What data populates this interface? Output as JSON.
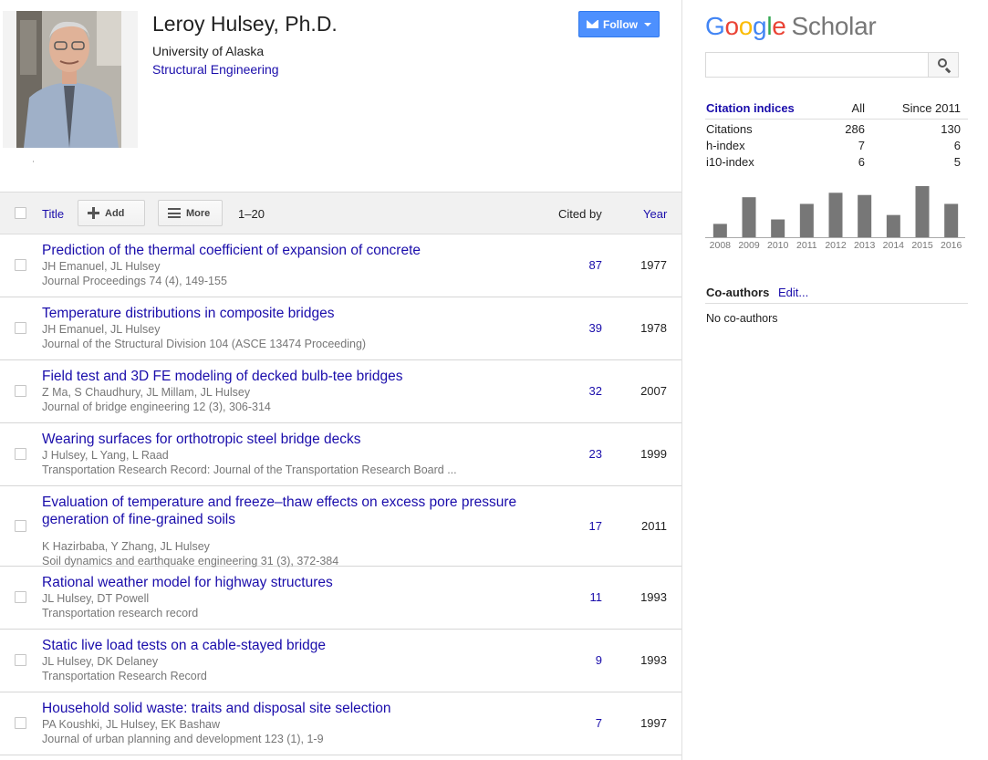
{
  "profile": {
    "name": "Leroy Hulsey, Ph.D.",
    "affiliation": "University of Alaska",
    "interest": "Structural Engineering",
    "follow_label": "Follow"
  },
  "toolbar": {
    "title_label": "Title",
    "add_label": "Add",
    "more_label": "More",
    "range": "1–20",
    "cited_by_label": "Cited by",
    "year_label": "Year"
  },
  "articles": [
    {
      "title": "Prediction of the thermal coefficient of expansion of concrete",
      "authors": "JH Emanuel, JL Hulsey",
      "venue": "Journal Proceedings 74 (4), 149-155",
      "cited": "87",
      "year": "1977"
    },
    {
      "title": "Temperature distributions in composite bridges",
      "authors": "JH Emanuel, JL Hulsey",
      "venue": "Journal of the Structural Division 104 (ASCE 13474 Proceeding)",
      "cited": "39",
      "year": "1978"
    },
    {
      "title": "Field test and 3D FE modeling of decked bulb-tee bridges",
      "authors": "Z Ma, S Chaudhury, JL Millam, JL Hulsey",
      "venue": "Journal of bridge engineering 12 (3), 306-314",
      "cited": "32",
      "year": "2007"
    },
    {
      "title": "Wearing surfaces for orthotropic steel bridge decks",
      "authors": "J Hulsey, L Yang, L Raad",
      "venue": "Transportation Research Record: Journal of the Transportation Research Board ...",
      "cited": "23",
      "year": "1999"
    },
    {
      "title": "Evaluation of temperature and freeze–thaw effects on excess pore pressure generation of fine-grained soils",
      "authors": "K Hazirbaba, Y Zhang, JL Hulsey",
      "venue": "Soil dynamics and earthquake engineering 31 (3), 372-384",
      "cited": "17",
      "year": "2011"
    },
    {
      "title": "Rational weather model for highway structures",
      "authors": "JL Hulsey, DT Powell",
      "venue": "Transportation research record",
      "cited": "11",
      "year": "1993"
    },
    {
      "title": "Static live load tests on a cable-stayed bridge",
      "authors": "JL Hulsey, DK Delaney",
      "venue": "Transportation Research Record",
      "cited": "9",
      "year": "1993"
    },
    {
      "title": "Household solid waste: traits and disposal site selection",
      "authors": "PA Koushki, JL Hulsey, EK Bashaw",
      "venue": "Journal of urban planning and development 123 (1), 1-9",
      "cited": "7",
      "year": "1997"
    }
  ],
  "scholar": {
    "logo_letters": [
      "G",
      "o",
      "o",
      "g",
      "l",
      "e"
    ],
    "logo_suffix": "Scholar",
    "search_placeholder": ""
  },
  "citation_indices": {
    "title": "Citation indices",
    "col_all": "All",
    "col_since": "Since 2011",
    "rows": [
      {
        "label": "Citations",
        "all": "286",
        "since": "130"
      },
      {
        "label": "h-index",
        "all": "7",
        "since": "6"
      },
      {
        "label": "i10-index",
        "all": "6",
        "since": "5"
      }
    ]
  },
  "chart_data": {
    "type": "bar",
    "categories": [
      "2008",
      "2009",
      "2010",
      "2011",
      "2012",
      "2013",
      "2014",
      "2015",
      "2016"
    ],
    "values": [
      6,
      18,
      8,
      15,
      20,
      19,
      10,
      23,
      15
    ],
    "bar_color": "#777777",
    "title": "",
    "xlabel": "",
    "ylabel": ""
  },
  "coauthors": {
    "title": "Co-authors",
    "edit_label": "Edit...",
    "empty_text": "No co-authors"
  }
}
